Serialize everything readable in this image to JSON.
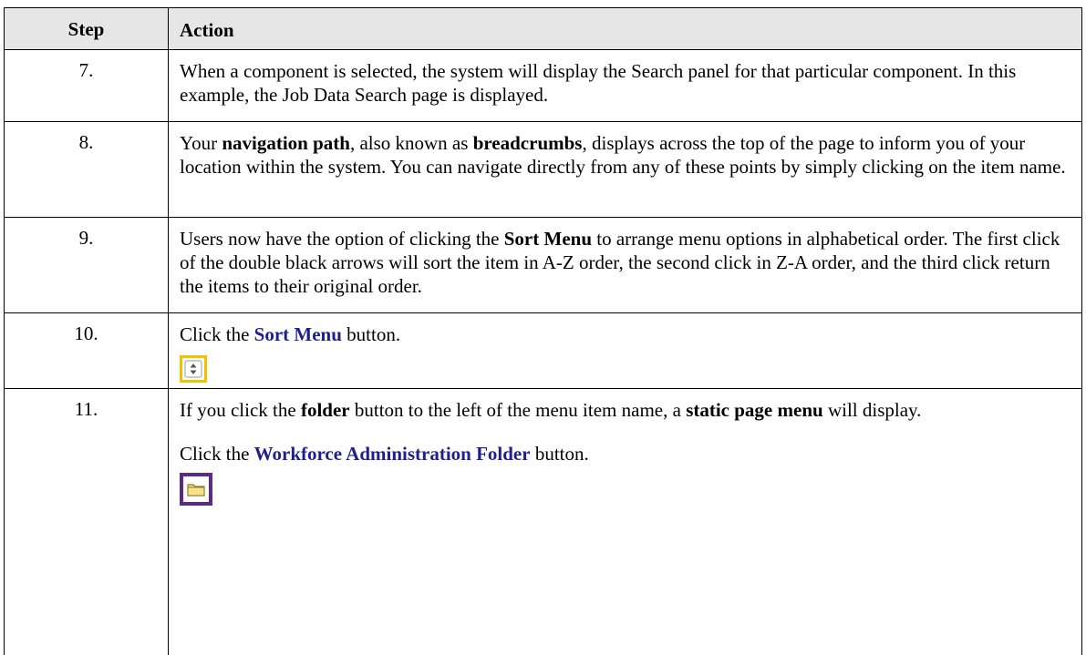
{
  "header": {
    "step": "Step",
    "action": "Action"
  },
  "rows": [
    {
      "step": "7.",
      "text": "When a component is selected, the system will display the Search panel for that particular component. In this example, the Job Data Search page is displayed."
    },
    {
      "step": "8.",
      "t1": "Your ",
      "b1": "navigation path",
      "t2": ", also known as ",
      "b2": "breadcrumbs",
      "t3": ", displays across the top of the page to inform you of your location within the system. You can navigate directly from any of these points by simply clicking on the item name."
    },
    {
      "step": "9.",
      "t1": "Users now have the option of clicking the ",
      "b1": "Sort Menu",
      "t2": " to arrange menu options in alphabetical order. The first click of the double black arrows will sort the item in A-Z order, the second click in Z-A order, and the third click return the items to their original order."
    },
    {
      "step": "10.",
      "t1": "Click the ",
      "b1": "Sort Menu",
      "t2": " button.",
      "icon": "sort-menu-icon"
    },
    {
      "step": "11.",
      "t1": "If you click the ",
      "b1": "folder",
      "t2": " button to the left of the menu item name, a ",
      "b2": "static page menu",
      "t3": " will display.",
      "t4": "Click the ",
      "b3": "Workforce Administration Folder",
      "t5": " button.",
      "icon": "folder-icon"
    }
  ],
  "colors": {
    "header_bg": "#e6e6e6",
    "link": "#1f1f8f",
    "sort_icon_border": "#f2c200",
    "folder_icon_border": "#5a2a8a",
    "folder_fill": "#f7d774"
  }
}
